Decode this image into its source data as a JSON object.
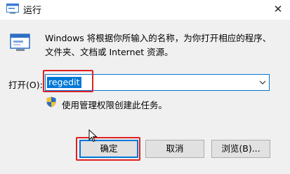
{
  "window": {
    "title": "运行",
    "close_glyph": "✕",
    "app_icon": "run-icon",
    "close_icon": "close-icon"
  },
  "description": {
    "line1": "Windows 将根据你所输入的名称，为你打开相应的程序、",
    "line2": "文件夹、文档或 Internet 资源。",
    "icon": "run-program-icon"
  },
  "open_field": {
    "label": "打开(O):",
    "value": "regedit",
    "dropdown_icon": "chevron-down-icon"
  },
  "admin_notice": {
    "text": "使用管理权限创建此任务。",
    "icon": "uac-shield-icon"
  },
  "buttons": {
    "ok": "确定",
    "cancel": "取消",
    "browse": "浏览(B)..."
  },
  "colors": {
    "accent": "#0078d7",
    "highlight_box": "#e02020",
    "background": "#f0f0f0"
  }
}
